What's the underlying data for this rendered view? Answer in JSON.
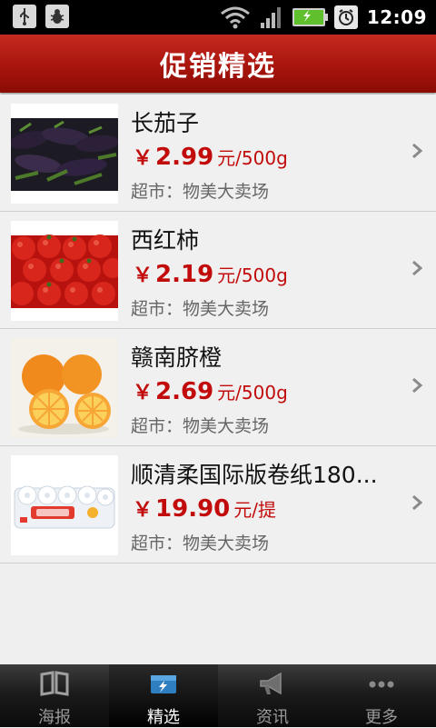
{
  "status_bar": {
    "time": "12:09"
  },
  "header": {
    "title": "促销精选"
  },
  "items": [
    {
      "name": "长茄子",
      "currency": "￥",
      "price": "2.99",
      "unit": "元/500g",
      "store": "超市：物美大卖场",
      "image": "eggplant-image"
    },
    {
      "name": "西红柿",
      "currency": "￥",
      "price": "2.19",
      "unit": "元/500g",
      "store": "超市：物美大卖场",
      "image": "tomato-image"
    },
    {
      "name": "赣南脐橙",
      "currency": "￥",
      "price": "2.69",
      "unit": "元/500g",
      "store": "超市：物美大卖场",
      "image": "orange-image"
    },
    {
      "name": "顺清柔国际版卷纸180...",
      "currency": "￥",
      "price": "19.90",
      "unit": "元/提",
      "store": "超市：物美大卖场",
      "image": "tissue-roll-image"
    }
  ],
  "nav": [
    {
      "label": "海报",
      "icon": "book-icon",
      "active": false
    },
    {
      "label": "精选",
      "icon": "featured-icon",
      "active": true
    },
    {
      "label": "资讯",
      "icon": "megaphone-icon",
      "active": false
    },
    {
      "label": "更多",
      "icon": "more-dots-icon",
      "active": false
    }
  ],
  "colors": {
    "accent": "#b01a10",
    "price": "#c20b0b"
  }
}
